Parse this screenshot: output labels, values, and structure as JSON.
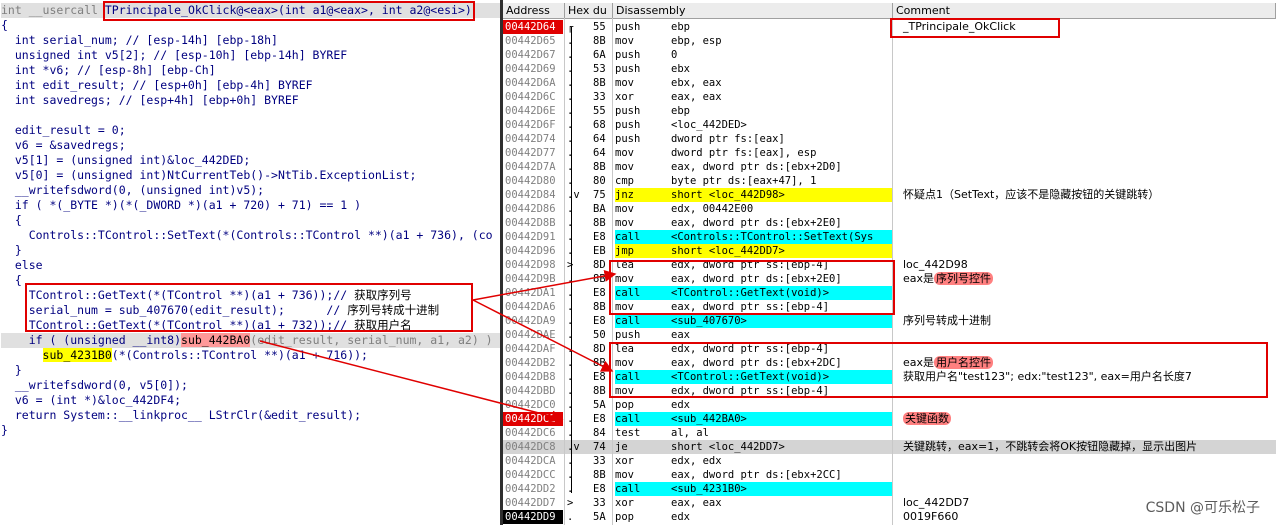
{
  "pseudocode": {
    "sig_prefix": "int __usercall ",
    "sig_func": "TPrincipale_OkClick@<eax>(int a1@<eax>, int a2@<esi>)",
    "lines": [
      "{",
      "  int serial_num; // [esp-14h] [ebp-18h]",
      "  unsigned int v5[2]; // [esp-10h] [ebp-14h] BYREF",
      "  int *v6; // [esp-8h] [ebp-Ch]",
      "  int edit_result; // [esp+0h] [ebp-4h] BYREF",
      "  int savedregs; // [esp+4h] [ebp+0h] BYREF",
      "",
      "  edit_result = 0;",
      "  v6 = &savedregs;",
      "  v5[1] = (unsigned int)&loc_442DED;",
      "  v5[0] = (unsigned int)NtCurrentTeb()->NtTib.ExceptionList;",
      "  __writefsdword(0, (unsigned int)v5);",
      "  if ( *(_BYTE *)(*(_DWORD *)(a1 + 720) + 71) == 1 )",
      "  {",
      "    Controls::TControl::SetText(*(Controls::TControl **)(a1 + 736), (co",
      "  }",
      "  else",
      "  {",
      "    TControl::GetText(*(TControl **)(a1 + 736));// ",
      "    serial_num = sub_407670(edit_result);      // ",
      "    TControl::GetText(*(TControl **)(a1 + 732));// ",
      "    if ( (unsigned __int8)",
      "      ",
      "  }",
      "  __writefsdword(0, v5[0]);",
      "  v6 = (int *)&loc_442DF4;",
      "  return System::__linkproc__ LStrClr(&edit_result);",
      "}"
    ],
    "comment_get_serial": "获取序列号",
    "comment_serial_hex": "序列号转成十进制",
    "comment_get_user": "获取用户名",
    "if_call": "sub_442BA0",
    "if_args": "(edit_result, serial_num, a1, a2) )",
    "sub_call": "sub_4231B0",
    "sub_args": "(*(Controls::TControl **)(a1 + 716));"
  },
  "disasm": {
    "headers": {
      "address": "Address",
      "hex": "Hex du",
      "disasm": "Disassembly",
      "comment": "Comment"
    },
    "rows": [
      {
        "addr": "00442D64",
        "arrow": "┌",
        "hex": "55",
        "mn": "push",
        "op": "ebp",
        "cm": "_TPrincipale_OkClick",
        "addr_style": "red"
      },
      {
        "addr": "00442D65",
        "arrow": ".",
        "hex": "8B",
        "mn": "mov",
        "op": "ebp, esp",
        "cm": ""
      },
      {
        "addr": "00442D67",
        "arrow": ".",
        "hex": "6A",
        "mn": "push",
        "op": "0",
        "cm": ""
      },
      {
        "addr": "00442D69",
        "arrow": ".",
        "hex": "53",
        "mn": "push",
        "op": "ebx",
        "cm": ""
      },
      {
        "addr": "00442D6A",
        "arrow": ".",
        "hex": "8B",
        "mn": "mov",
        "op": "ebx, eax",
        "cm": ""
      },
      {
        "addr": "00442D6C",
        "arrow": ".",
        "hex": "33",
        "mn": "xor",
        "op": "eax, eax",
        "cm": ""
      },
      {
        "addr": "00442D6E",
        "arrow": ".",
        "hex": "55",
        "mn": "push",
        "op": "ebp",
        "cm": ""
      },
      {
        "addr": "00442D6F",
        "arrow": ".",
        "hex": "68",
        "mn": "push",
        "op": "<loc_442DED>",
        "cm": ""
      },
      {
        "addr": "00442D74",
        "arrow": ".",
        "hex": "64",
        "mn": "push",
        "op": "dword ptr fs:[eax]",
        "cm": ""
      },
      {
        "addr": "00442D77",
        "arrow": ".",
        "hex": "64",
        "mn": "mov",
        "op": "dword ptr fs:[eax], esp",
        "cm": ""
      },
      {
        "addr": "00442D7A",
        "arrow": ".",
        "hex": "8B",
        "mn": "mov",
        "op": "eax, dword ptr ds:[ebx+2D0]",
        "cm": ""
      },
      {
        "addr": "00442D80",
        "arrow": ".",
        "hex": "80",
        "mn": "cmp",
        "op": "byte ptr ds:[eax+47], 1",
        "cm": ""
      },
      {
        "addr": "00442D84",
        "arrow": ".v",
        "hex": "75",
        "mn": "jnz",
        "op": "short <loc_442D98>",
        "cm": "怀疑点1（SetText，应该不是隐藏按钮的关键跳转）",
        "style": "yel"
      },
      {
        "addr": "00442D86",
        "arrow": ".",
        "hex": "BA",
        "mn": "mov",
        "op": "edx, 00442E00",
        "cm": ""
      },
      {
        "addr": "00442D8B",
        "arrow": ".",
        "hex": "8B",
        "mn": "mov",
        "op": "eax, dword ptr ds:[ebx+2E0]",
        "cm": ""
      },
      {
        "addr": "00442D91",
        "arrow": ".",
        "hex": "E8",
        "mn": "call",
        "op": "<Controls::TControl::SetText(Sys",
        "cm": "",
        "style": "cyan"
      },
      {
        "addr": "00442D96",
        "arrow": ".",
        "hex": "EB",
        "mn": "jmp",
        "op": "short <loc_442DD7>",
        "cm": "",
        "style": "yel"
      },
      {
        "addr": "00442D98",
        "arrow": ">",
        "hex": "8D",
        "mn": "lea",
        "op": "edx, dword ptr ss:[ebp-4]",
        "cm": "loc_442D98"
      },
      {
        "addr": "00442D9B",
        "arrow": ".",
        "hex": "8B",
        "mn": "mov",
        "op": "eax, dword ptr ds:[ebx+2E0]",
        "cm": "eax是序列号控件",
        "pink": "序列号控件"
      },
      {
        "addr": "00442DA1",
        "arrow": ".",
        "hex": "E8",
        "mn": "call",
        "op": "<TControl::GetText(void)>",
        "cm": "",
        "style": "cyan"
      },
      {
        "addr": "00442DA6",
        "arrow": ".",
        "hex": "8B",
        "mn": "mov",
        "op": "eax, dword ptr ss:[ebp-4]",
        "cm": ""
      },
      {
        "addr": "00442DA9",
        "arrow": ".",
        "hex": "E8",
        "mn": "call",
        "op": "<sub_407670>",
        "cm": "序列号转成十进制",
        "style": "cyan"
      },
      {
        "addr": "00442DAE",
        "arrow": ".",
        "hex": "50",
        "mn": "push",
        "op": "eax",
        "cm": ""
      },
      {
        "addr": "00442DAF",
        "arrow": ".",
        "hex": "8D",
        "mn": "lea",
        "op": "edx, dword ptr ss:[ebp-4]",
        "cm": ""
      },
      {
        "addr": "00442DB2",
        "arrow": ".",
        "hex": "8B",
        "mn": "mov",
        "op": "eax, dword ptr ds:[ebx+2DC]",
        "cm": "eax是用户名控件",
        "pink": "用户名控件"
      },
      {
        "addr": "00442DB8",
        "arrow": ".",
        "hex": "E8",
        "mn": "call",
        "op": "<TControl::GetText(void)>",
        "cm": "获取用户名\"test123\"; edx:\"test123\", eax=用户名长度7",
        "style": "cyan"
      },
      {
        "addr": "00442DBD",
        "arrow": ".",
        "hex": "8B",
        "mn": "mov",
        "op": "edx, dword ptr ss:[ebp-4]",
        "cm": ""
      },
      {
        "addr": "00442DC0",
        "arrow": ".",
        "hex": "5A",
        "mn": "pop",
        "op": "edx",
        "cm": ""
      },
      {
        "addr": "00442DC1",
        "arrow": ".",
        "hex": "E8",
        "mn": "call",
        "op": "<sub_442BA0>",
        "cm": "关键函数",
        "style": "cyan",
        "addr_style": "red",
        "pink": "关键函数"
      },
      {
        "addr": "00442DC6",
        "arrow": ".",
        "hex": "84",
        "mn": "test",
        "op": "al, al",
        "cm": ""
      },
      {
        "addr": "00442DC8",
        "arrow": ".v",
        "hex": "74",
        "mn": "je",
        "op": "short <loc_442DD7>",
        "cm": "关键跳转，eax=1，不跳转会将OK按钮隐藏掉，显示出图片",
        "row_style": "gray"
      },
      {
        "addr": "00442DCA",
        "arrow": ".",
        "hex": "33",
        "mn": "xor",
        "op": "edx, edx",
        "cm": ""
      },
      {
        "addr": "00442DCC",
        "arrow": ".",
        "hex": "8B",
        "mn": "mov",
        "op": "eax, dword ptr ds:[ebx+2CC]",
        "cm": ""
      },
      {
        "addr": "00442DD2",
        "arrow": ".",
        "hex": "E8",
        "mn": "call",
        "op": "<sub_4231B0>",
        "cm": "",
        "style": "cyan"
      },
      {
        "addr": "00442DD7",
        "arrow": ">",
        "hex": "33",
        "mn": "xor",
        "op": "eax, eax",
        "cm": "loc_442DD7"
      },
      {
        "addr": "00442DD9",
        "arrow": ".",
        "hex": "5A",
        "mn": "pop",
        "op": "edx",
        "cm": "0019F660",
        "addr_style": "blk"
      }
    ]
  },
  "watermark": "CSDN @可乐松子"
}
